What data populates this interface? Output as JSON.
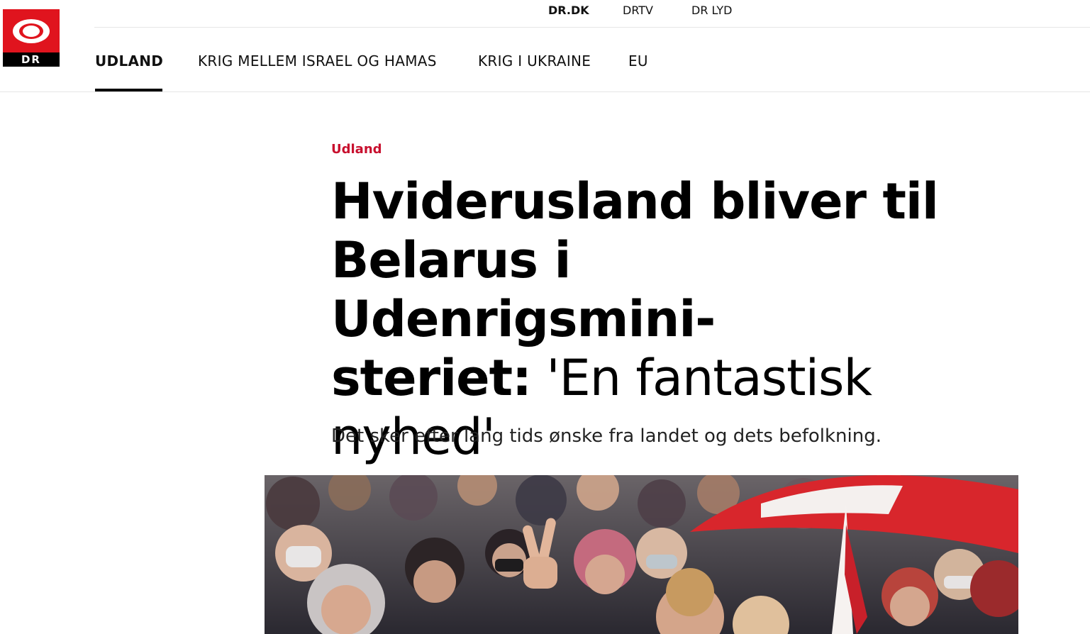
{
  "brand": {
    "logo_text": "DR",
    "logo_icon": "dr-eye-logo",
    "brand_red": "#e0141e"
  },
  "service_links": [
    {
      "label": "DR.DK",
      "active": true
    },
    {
      "label": "DRTV",
      "active": false
    },
    {
      "label": "DR LYD",
      "active": false
    }
  ],
  "section_nav": [
    {
      "label": "UDLAND",
      "active": true
    },
    {
      "label": "KRIG MELLEM ISRAEL OG HAMAS",
      "active": false
    },
    {
      "label": "KRIG I UKRAINE",
      "active": false
    },
    {
      "label": "EU",
      "active": false
    }
  ],
  "article": {
    "kicker": "Udland",
    "kicker_color": "#c8102e",
    "headline_bold_line1": "Hviderusland bliver til",
    "headline_bold_line2": "Belarus i Udenrigsmini-",
    "headline_bold_line3": "steriet:",
    "headline_quote_part1": " 'En fantastisk",
    "headline_quote_part2": "nyhed'",
    "summary": "Det sker efter lang tids ønske fra landet og dets befolkning."
  }
}
